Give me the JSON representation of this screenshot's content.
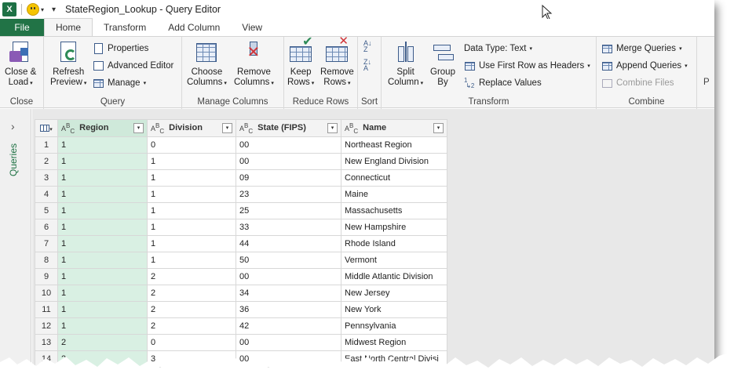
{
  "window": {
    "title": "StateRegion_Lookup - Query Editor"
  },
  "icons": {
    "excel": "excel-app-icon",
    "smiley": "feedback-smiley-icon",
    "quick_access": "quick-access-dropdown-icon",
    "cursor": "mouse-pointer-icon"
  },
  "app_letter": "X",
  "tabs": [
    {
      "label": "File"
    },
    {
      "label": "Home"
    },
    {
      "label": "Transform"
    },
    {
      "label": "Add Column"
    },
    {
      "label": "View"
    }
  ],
  "ribbon": {
    "close": {
      "group": "Close",
      "close_load_1": "Close &",
      "close_load_2": "Load"
    },
    "query": {
      "group": "Query",
      "refresh_1": "Refresh",
      "refresh_2": "Preview",
      "properties": "Properties",
      "advanced_editor": "Advanced Editor",
      "manage": "Manage"
    },
    "manage_columns": {
      "group": "Manage Columns",
      "choose_1": "Choose",
      "choose_2": "Columns",
      "remove_1": "Remove",
      "remove_2": "Columns"
    },
    "reduce_rows": {
      "group": "Reduce Rows",
      "keep_1": "Keep",
      "keep_2": "Rows",
      "remove_1": "Remove",
      "remove_2": "Rows"
    },
    "sort": {
      "group": "Sort"
    },
    "transform": {
      "group": "Transform",
      "split_1": "Split",
      "split_2": "Column",
      "group_by_1": "Group",
      "group_by_2": "By",
      "data_type": "Data Type: Text",
      "first_row": "Use First Row as Headers",
      "replace": "Replace Values"
    },
    "combine": {
      "group": "Combine",
      "merge": "Merge Queries",
      "append": "Append Queries",
      "combine_files": "Combine Files"
    },
    "cut_label": "P"
  },
  "queries_pane": {
    "label": "Queries"
  },
  "grid": {
    "columns": [
      {
        "type": "ABC",
        "name": "Region"
      },
      {
        "type": "ABC",
        "name": "Division"
      },
      {
        "type": "ABC",
        "name": "State (FIPS)"
      },
      {
        "type": "ABC",
        "name": "Name"
      }
    ],
    "rows": [
      {
        "n": "1",
        "region": "1",
        "division": "0",
        "state": "00",
        "name": "Northeast Region"
      },
      {
        "n": "2",
        "region": "1",
        "division": "1",
        "state": "00",
        "name": "New England Division"
      },
      {
        "n": "3",
        "region": "1",
        "division": "1",
        "state": "09",
        "name": "Connecticut"
      },
      {
        "n": "4",
        "region": "1",
        "division": "1",
        "state": "23",
        "name": "Maine"
      },
      {
        "n": "5",
        "region": "1",
        "division": "1",
        "state": "25",
        "name": "Massachusetts"
      },
      {
        "n": "6",
        "region": "1",
        "division": "1",
        "state": "33",
        "name": "New Hampshire"
      },
      {
        "n": "7",
        "region": "1",
        "division": "1",
        "state": "44",
        "name": "Rhode Island"
      },
      {
        "n": "8",
        "region": "1",
        "division": "1",
        "state": "50",
        "name": "Vermont"
      },
      {
        "n": "9",
        "region": "1",
        "division": "2",
        "state": "00",
        "name": "Middle Atlantic Division"
      },
      {
        "n": "10",
        "region": "1",
        "division": "2",
        "state": "34",
        "name": "New Jersey"
      },
      {
        "n": "11",
        "region": "1",
        "division": "2",
        "state": "36",
        "name": "New York"
      },
      {
        "n": "12",
        "region": "1",
        "division": "2",
        "state": "42",
        "name": "Pennsylvania"
      },
      {
        "n": "13",
        "region": "2",
        "division": "0",
        "state": "00",
        "name": "Midwest Region"
      },
      {
        "n": "14",
        "region": "2",
        "division": "3",
        "state": "00",
        "name": "East North Central Divisi"
      }
    ]
  },
  "colors": {
    "file_tab": "#217346",
    "selected_column": "#d9f0e3",
    "ribbon_bg": "#f5f5f5"
  }
}
